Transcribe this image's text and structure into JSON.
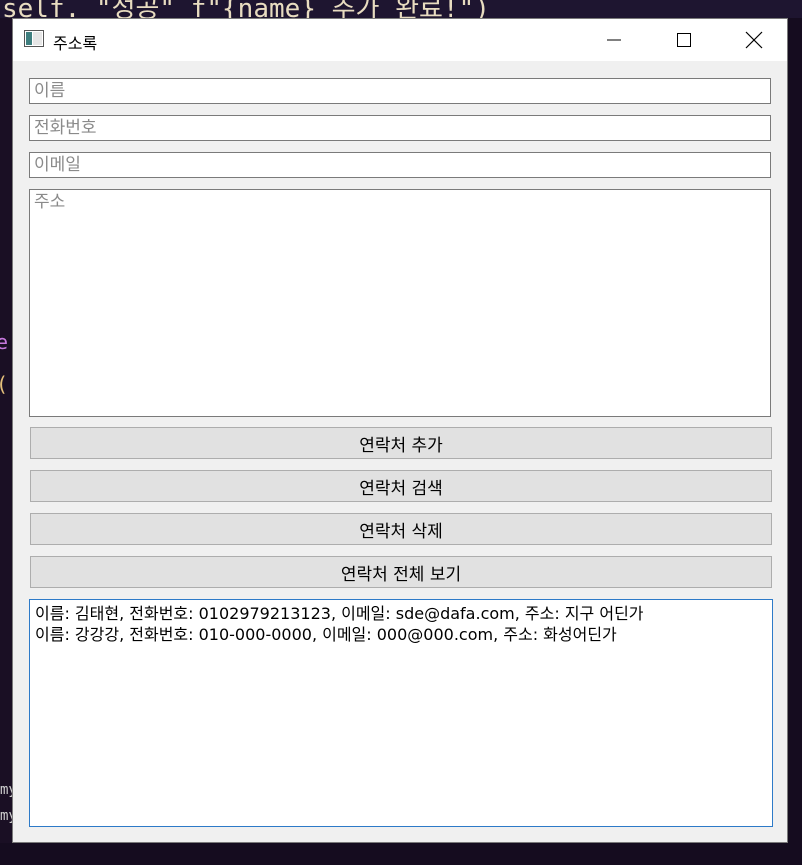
{
  "background": {
    "code_fragment": "self. \"성공\" f\"{name} 추가 완료!\")",
    "left_fragments": [
      "e",
      "(",
      "my",
      "my"
    ]
  },
  "window": {
    "title": "주소록",
    "controls": {
      "minimize_icon": "minimize-icon",
      "maximize_icon": "maximize-icon",
      "close_icon": "close-icon"
    }
  },
  "form": {
    "name_placeholder": "이름",
    "phone_placeholder": "전화번호",
    "email_placeholder": "이메일",
    "address_placeholder": "주소"
  },
  "buttons": {
    "add": "연락처 추가",
    "search": "연락처 검색",
    "delete": "연락처 삭제",
    "view_all": "연락처 전체 보기"
  },
  "output": {
    "lines": [
      "이름: 김태현, 전화번호: 0102979213123, 이메일: sde@dafa.com, 주소: 지구 어딘가",
      "이름: 강강강, 전화번호: 010-000-0000, 이메일: 000@000.com, 주소: 화성어딘가"
    ]
  },
  "colors": {
    "accent_border": "#2d7ac8",
    "button_bg": "#e1e1e1",
    "window_bg": "#f0f0f0"
  }
}
